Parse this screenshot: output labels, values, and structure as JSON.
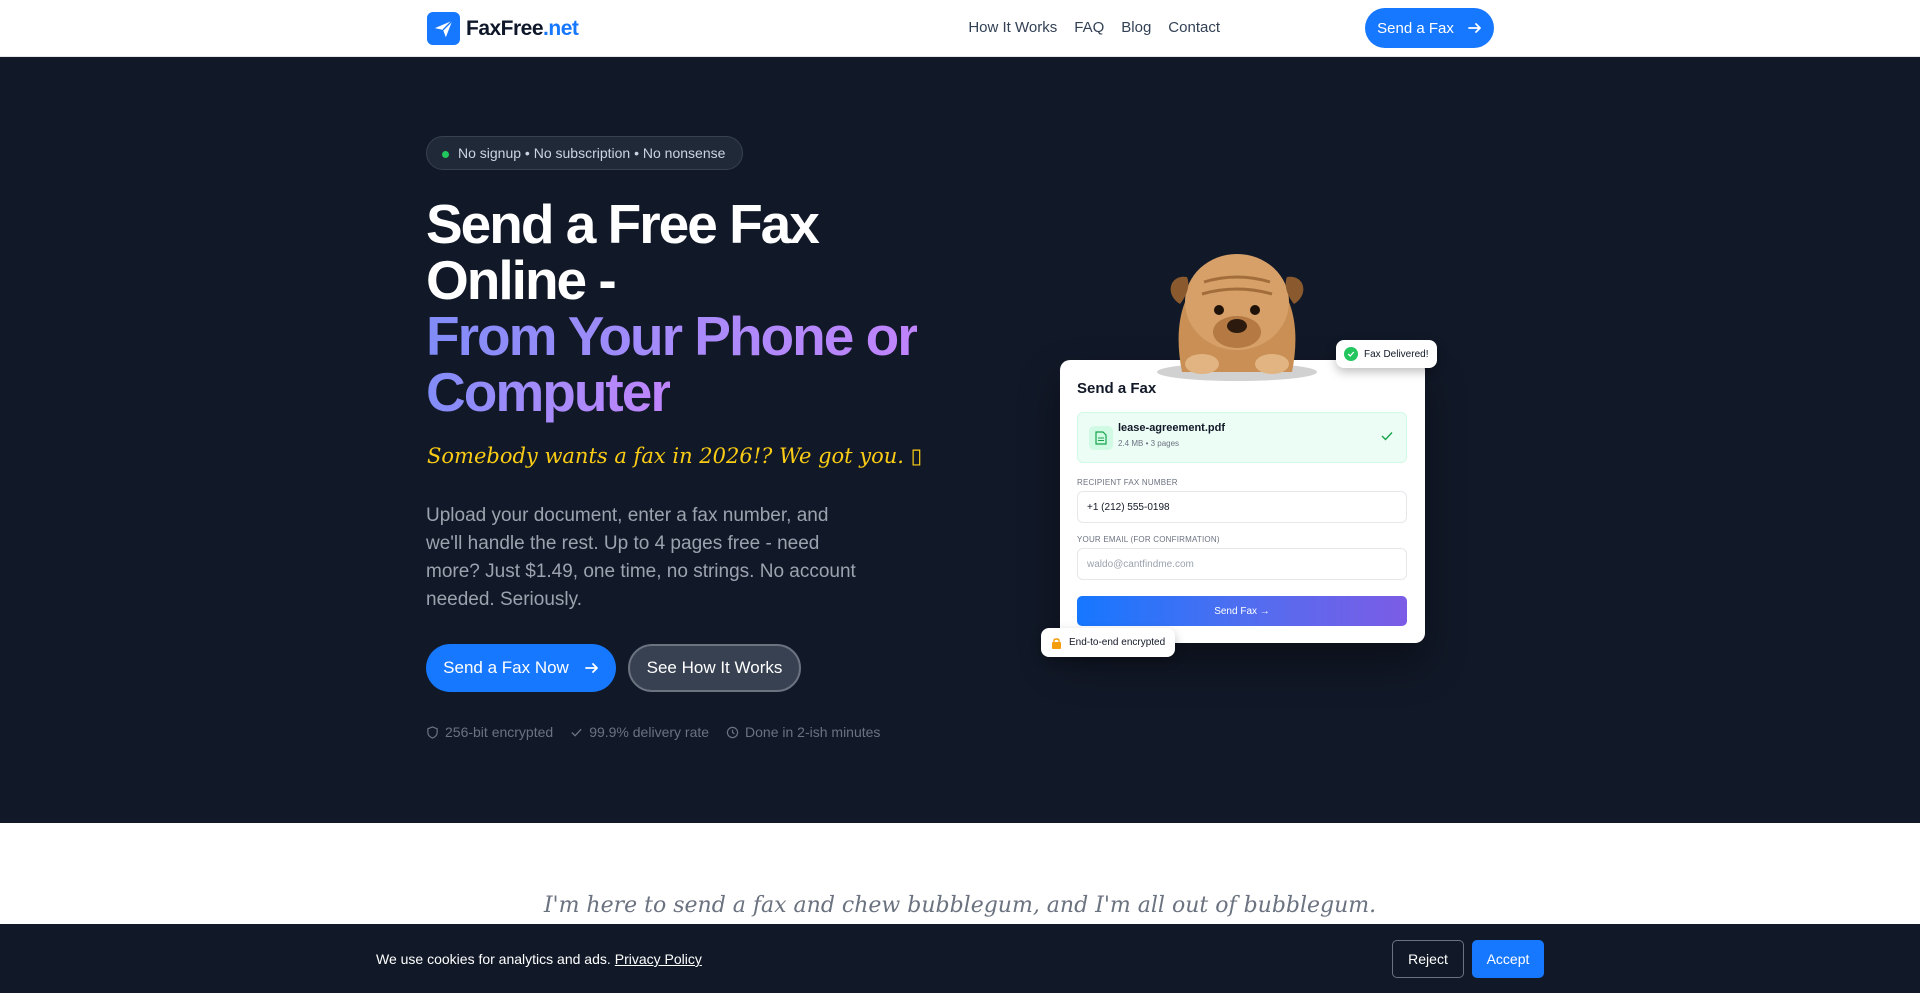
{
  "header": {
    "logo_text_a": "FaxFree",
    "logo_text_b": ".net",
    "nav": [
      "How It Works",
      "FAQ",
      "Blog",
      "Contact"
    ],
    "cta_label": "Send a Fax"
  },
  "hero": {
    "pill": "No signup • No subscription • No nonsense",
    "headline_line1": "Send a Free Fax",
    "headline_line2": "Online -",
    "headline_grad1": "From Your Phone or",
    "headline_grad2": "Computer",
    "tagline": "Somebody wants a fax in 2026!? We got you. ▯",
    "description": "Upload your document, enter a fax number, and we'll handle the rest. Up to 4 pages free - need more? Just $1.49, one time, no strings. No account needed. Seriously.",
    "primary_cta": "Send a Fax Now",
    "secondary_cta": "See How It Works",
    "trust": [
      "256-bit encrypted",
      "99.9% delivery rate",
      "Done in 2-ish minutes"
    ]
  },
  "mockup": {
    "title": "Send a Fax",
    "file_name": "lease-agreement.pdf",
    "file_meta": "2.4 MB • 3 pages",
    "recipient_label": "RECIPIENT FAX NUMBER",
    "recipient_value": "+1 (212) 555-0198",
    "email_label": "YOUR EMAIL (FOR CONFIRMATION)",
    "email_placeholder": "waldo@cantfindme.com",
    "send_button": "Send Fax →",
    "delivered_badge": "Fax Delivered!",
    "encrypted_badge": "End-to-end encrypted"
  },
  "quote": "I'm here to send a fax and chew bubblegum, and I'm all out of bubblegum.",
  "cookie": {
    "text": "We use cookies for analytics and ads.",
    "link": "Privacy Policy",
    "reject": "Reject",
    "accept": "Accept"
  },
  "colors": {
    "brand": "#1677ff",
    "hero_bg": "#111827",
    "accent_yellow": "#facc15",
    "success": "#22c55e"
  }
}
